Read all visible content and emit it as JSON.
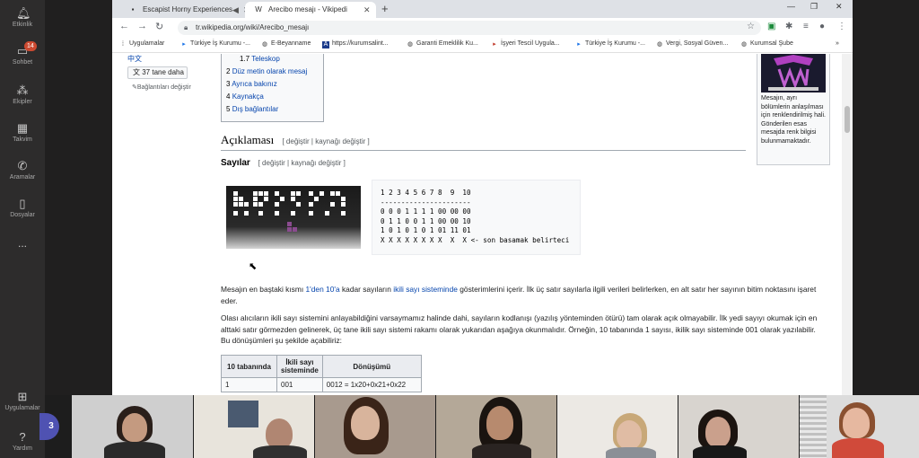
{
  "rail": {
    "items": [
      {
        "label": "Etkinlik",
        "icon": "bell-icon"
      },
      {
        "label": "Sohbet",
        "icon": "chat-icon",
        "badge": "14"
      },
      {
        "label": "Ekipler",
        "icon": "teams-icon"
      },
      {
        "label": "Takvim",
        "icon": "calendar-icon"
      },
      {
        "label": "Aramalar",
        "icon": "phone-icon"
      },
      {
        "label": "Dosyalar",
        "icon": "files-icon"
      },
      {
        "label": "...",
        "icon": "more-icon"
      },
      {
        "label": "Uygulamalar",
        "icon": "apps-icon"
      },
      {
        "label": "Yardım",
        "icon": "help-icon"
      }
    ]
  },
  "browser": {
    "tabs": [
      {
        "title": "Escapist Horny Experiences"
      },
      {
        "title": "Arecibo mesajı - Vikipedi"
      }
    ],
    "url": "tr.wikipedia.org/wiki/Arecibo_mesajı",
    "bookmarks": [
      "Uygulamalar",
      "Türkiye İş Kurumu -...",
      "E-Beyanname",
      "https://kurumsalint...",
      "Garanti Emeklilik Ku...",
      "İşyeri Tescil Uygula...",
      "Türkiye İş Kurumu -...",
      "Vergi, Sosyal Güven...",
      "Kurumsal Şube"
    ]
  },
  "sidebar": {
    "lang_zh": "中文",
    "lang_more": "37 tane daha",
    "lang_links": "Bağlantıları değiştir"
  },
  "toc": {
    "items": [
      {
        "num": "1.7",
        "label": "Teleskop"
      },
      {
        "num": "2",
        "label": "Düz metin olarak mesaj"
      },
      {
        "num": "3",
        "label": "Ayrıca bakınız"
      },
      {
        "num": "4",
        "label": "Kaynakça"
      },
      {
        "num": "5",
        "label": "Dış bağlantılar"
      }
    ]
  },
  "infobox": {
    "caption": "Mesajın, ayrı bölümlerin anlaşılması için renklendirilmiş hali. Gönderilen esas mesajda renk bilgisi bulunmamaktadır."
  },
  "article": {
    "h2": "Açıklaması",
    "edit_links": "[ değiştir | kaynağı değiştir ]",
    "h3": "Sayılar",
    "pre_lines": [
      "1 2 3 4 5 6 7 8  9  10",
      "----------------------",
      "0 0 0 1 1 1 1 00 00 00",
      "0 1 1 0 0 1 1 00 00 10",
      "1 0 1 0 1 0 1 01 11 01",
      "X X X X X X X X  X  X <- son basamak belirteci"
    ],
    "para1_a": "Mesajın en baştaki kısmı ",
    "para1_link1": "1'den 10'a",
    "para1_b": " kadar sayıların ",
    "para1_link2": "ikili sayı sisteminde",
    "para1_c": " gösterimlerini içerir. İlk üç satır sayılarla ilgili verileri belirlerken, en alt satır her sayının bitim noktasını işaret eder.",
    "para2": "Olası alıcıların ikili sayı sistemini anlayabildiğini varsaymamız halinde dahi, sayıların kodlanışı (yazılış yönteminden ötürü) tam olarak açık olmayabilir. İlk yedi sayıyı okumak için en alttaki satır görmezden gelinerek, üç tane ikili sayı sistemi rakamı olarak yukarıdan aşağıya okunmalıdır. Örneğin, 10 tabanında 1 sayısı, ikilik sayı sisteminde 001 olarak yazılabilir. Bu dönüşümleri şu şekilde açabiliriz:",
    "table": {
      "headers": [
        "10 tabanında",
        "İkili sayı sisteminde",
        "Dönüşümü"
      ],
      "rows": [
        [
          "1",
          "001",
          "0012 = 1x20+0x21+0x22"
        ]
      ]
    }
  },
  "meeting": {
    "participant_count": "3"
  }
}
